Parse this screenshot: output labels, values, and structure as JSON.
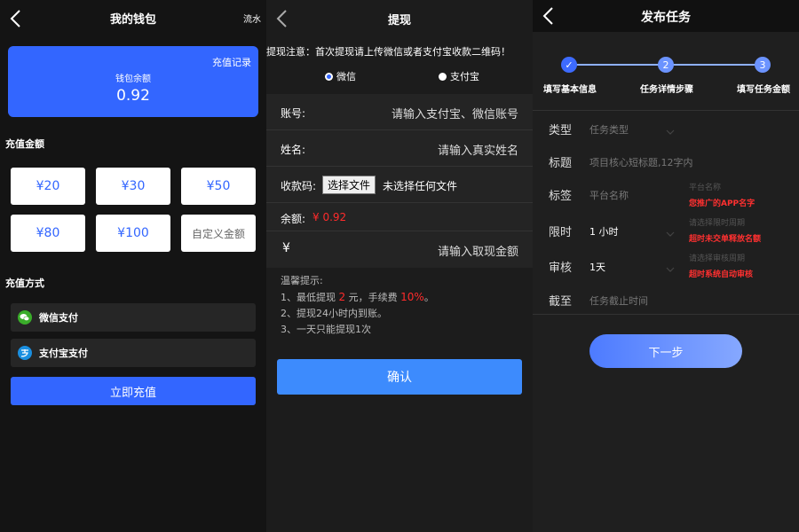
{
  "wallet": {
    "title": "我的钱包",
    "flow_link": "流水",
    "recharge_record": "充值记录",
    "balance_label": "钱包余额",
    "balance_value": "0.92",
    "amount_section": "充值金额",
    "amounts": [
      "¥20",
      "¥30",
      "¥50",
      "¥80",
      "¥100",
      "自定义金额"
    ],
    "method_section": "充值方式",
    "methods": [
      "微信支付",
      "支付宝支付"
    ],
    "submit": "立即充值",
    "colors": {
      "accent": "#3366ff",
      "wechat": "#3aad2a",
      "alipay": "#1a8fe0"
    }
  },
  "withdraw": {
    "title": "提现",
    "notice": "提现注意：首次提现请上传微信或者支付宝收款二维码！",
    "options": [
      "微信",
      "支付宝"
    ],
    "account_label": "账号:",
    "account_placeholder": "请输入支付宝、微信账号",
    "name_label": "姓名:",
    "name_placeholder": "请输入真实姓名",
    "qrcode_label": "收款码:",
    "file_button": "选择文件",
    "file_status": "未选择任何文件",
    "balance_label": "余额:",
    "balance_value": "¥ 0.92",
    "currency_symbol": "¥",
    "amount_placeholder": "请输入取现金额",
    "tips": {
      "heading": "温馨提示:",
      "line1_a": "1、最低提现",
      "line1_min": "2",
      "line1_b": "元，手续费",
      "line1_fee": "10%",
      "line1_c": "。",
      "line2": "2、提现24小时内到账。",
      "line3": "3、一天只能提现1次"
    },
    "confirm": "确认"
  },
  "task": {
    "title": "发布任务",
    "steps": [
      {
        "number": "✓",
        "label": "填写基本信息"
      },
      {
        "number": "2",
        "label": "任务详情步骤"
      },
      {
        "number": "3",
        "label": "填写任务金额"
      }
    ],
    "fields": {
      "type_label": "类型",
      "type_placeholder": "任务类型",
      "headline_label": "标题",
      "headline_placeholder": "项目核心短标题,12字内",
      "tag_label": "标签",
      "tag_placeholder": "平台名称",
      "tag_hint": "平台名称",
      "tag_warn": "您推广的APP名字",
      "limit_label": "限时",
      "limit_value": "1 小时",
      "limit_hint": "请选择限时周期",
      "limit_warn": "超时未交单释放名额",
      "review_label": "审核",
      "review_value": "1天",
      "review_hint": "请选择审核周期",
      "review_warn": "超时系统自动审核",
      "deadline_label": "截至",
      "deadline_placeholder": "任务截止时间"
    },
    "next": "下一步"
  }
}
